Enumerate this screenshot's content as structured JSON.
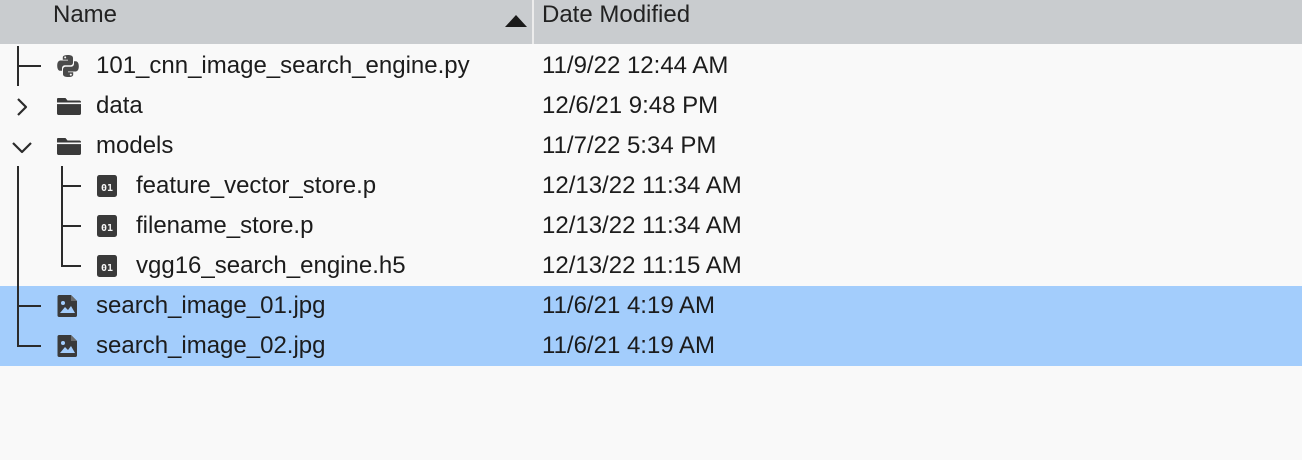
{
  "header": {
    "name_label": "Name",
    "date_label": "Date Modified",
    "sort_icon": "sort-ascending-icon"
  },
  "rows": [
    {
      "name": "101_cnn_image_search_engine.py",
      "date": "11/9/22 12:44 AM",
      "icon": "python-file-icon",
      "selected": false
    },
    {
      "name": "data",
      "date": "12/6/21 9:48 PM",
      "icon": "folder-icon",
      "expander": "collapsed",
      "selected": false
    },
    {
      "name": "models",
      "date": "11/7/22 5:34 PM",
      "icon": "folder-icon",
      "expander": "expanded",
      "selected": false
    },
    {
      "name": "feature_vector_store.p",
      "date": "12/13/22 11:34 AM",
      "icon": "binary-file-icon",
      "selected": false
    },
    {
      "name": "filename_store.p",
      "date": "12/13/22 11:34 AM",
      "icon": "binary-file-icon",
      "selected": false
    },
    {
      "name": "vgg16_search_engine.h5",
      "date": "12/13/22 11:15 AM",
      "icon": "binary-file-icon",
      "selected": false
    },
    {
      "name": "search_image_01.jpg",
      "date": "11/6/21 4:19 AM",
      "icon": "image-file-icon",
      "selected": true
    },
    {
      "name": "search_image_02.jpg",
      "date": "11/6/21 4:19 AM",
      "icon": "image-file-icon",
      "selected": true
    }
  ],
  "colors": {
    "header_bg": "#c9cccf",
    "selection_bg": "#a3cdfc",
    "background": "#f9f9f9"
  }
}
